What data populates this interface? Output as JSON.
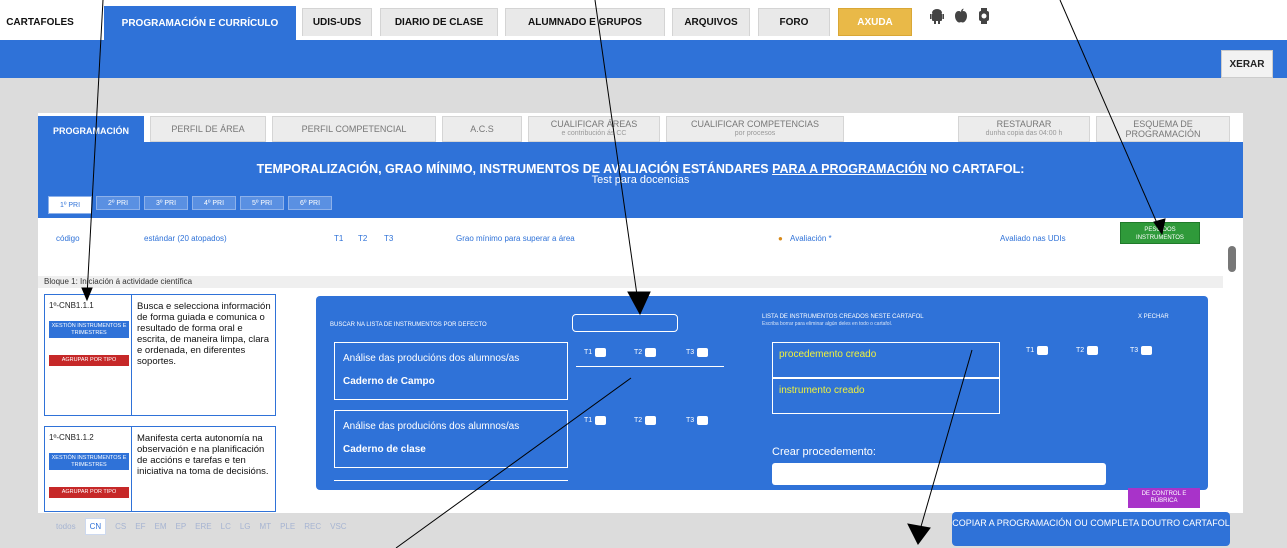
{
  "topnav": {
    "tabs": [
      {
        "label": "CARTAFOLES"
      },
      {
        "label": "PROGRAMACIÓN E CURRÍCULO"
      },
      {
        "label": "UDIS-UDS"
      },
      {
        "label": "DIARIO DE CLASE"
      },
      {
        "label": "ALUMNADO E GRUPOS"
      },
      {
        "label": "ARQUIVOS"
      },
      {
        "label": "FORO"
      },
      {
        "label": "AXUDA"
      }
    ],
    "platform_icons": [
      "android-icon",
      "apple-icon",
      "device-icon"
    ]
  },
  "toolbar": {
    "xerar_label": "XERAR"
  },
  "subtabs": {
    "programacion": "PROGRAMACIÓN",
    "perfil_area": "PERFIL DE ÁREA",
    "perfil_competencial": "PERFIL COMPETENCIAL",
    "acs": "A.C.S",
    "cualificar_areas": "CUALIFICAR ÁREAS",
    "cualificar_areas_sub": "e contribución ás CC",
    "cualificar_competencias": "CUALIFICAR COMPETENCIAS",
    "cualificar_competencias_sub": "por procesos",
    "restaurar": "RESTAURAR",
    "restaurar_sub": "dunha copia das 04:00 h",
    "esquema": "ESQUEMA DE PROGRAMACIÓN"
  },
  "header": {
    "title_a": "TEMPORALIZACIÓN, GRAO MÍNIMO, INSTRUMENTOS DE AVALIACIÓN ESTÁNDARES ",
    "title_link": "PARA A PROGRAMACIÓN",
    "title_b": " NO CARTAFOL:",
    "subtitle": "Test para docencias"
  },
  "grades": [
    "1º PRI",
    "2º PRI",
    "3º PRI",
    "4º PRI",
    "5º PRI",
    "6º PRI"
  ],
  "columns": {
    "codigo": "código",
    "estandar": "estándar (20 atopados)",
    "t1": "T1",
    "t2": "T2",
    "t3": "T3",
    "grao": "Grao mínimo para superar a área",
    "avaliacion": "Avaliación *",
    "avaliado": "Avaliado nas UDIs",
    "peso": "PESO DOS INSTRUMENTOS"
  },
  "bloque": "Bloque 1: Iniciación á actividade científica",
  "rows": [
    {
      "code": "1º-CNB1.1.1",
      "desc": "Busca e selecciona información de forma guiada e comunica o resultado de forma oral e escrita, de maneira limpa, clara e ordenada, en diferentes soportes.",
      "btn_blue": "XESTIÓN INSTRUMENTOS E TRIMESTRES",
      "btn_red": "AGRUPAR POR TIPO"
    },
    {
      "code": "1º-CNB1.1.2",
      "desc": "Manifesta certa autonomía na observación e na planificación de accións e tarefas e ten iniciativa na toma de decisións.",
      "btn_blue": "XESTIÓN INSTRUMENTOS E TRIMESTRES",
      "btn_red": "AGRUPAR POR TIPO"
    }
  ],
  "modal": {
    "search_label": "BUSCAR NA LISTA DE INSTRUMENTOS POR DEFECTO",
    "list_title": "LISTA DE INSTRUMENTOS CREADOS NESTE CARTAFOL",
    "list_hint": "Escriba borrar para eliminar algún deles en todo o cartafol.",
    "close_label": "X PECHAR",
    "t1": "T1",
    "t2": "T2",
    "t3": "T3",
    "instruments": [
      {
        "title": "Análise das producións dos alumnos/as",
        "type": "Caderno de Campo"
      },
      {
        "title": "Análise das producións dos alumnos/as",
        "type": "Caderno de clase"
      }
    ],
    "created": [
      "procedemento creado",
      "instrumento creado"
    ],
    "new_proc_label": "Crear procedemento:"
  },
  "purple_label": "DE CONTROL E RÚBRICA",
  "subjects": [
    "todos",
    "CN",
    "CS",
    "EF",
    "EM",
    "EP",
    "ERE",
    "LC",
    "LG",
    "MT",
    "PLE",
    "REC",
    "VSC"
  ],
  "copy_label": "COPIAR A PROGRAMACIÓN OU COMPLETA DOUTRO CARTAFOL",
  "colors": {
    "primary": "#2f72d8",
    "axuda": "#e9b948",
    "peso": "#2f9a3a",
    "danger": "#c62828",
    "created_text": "#f0f23c",
    "rubrica": "#a833c9"
  }
}
